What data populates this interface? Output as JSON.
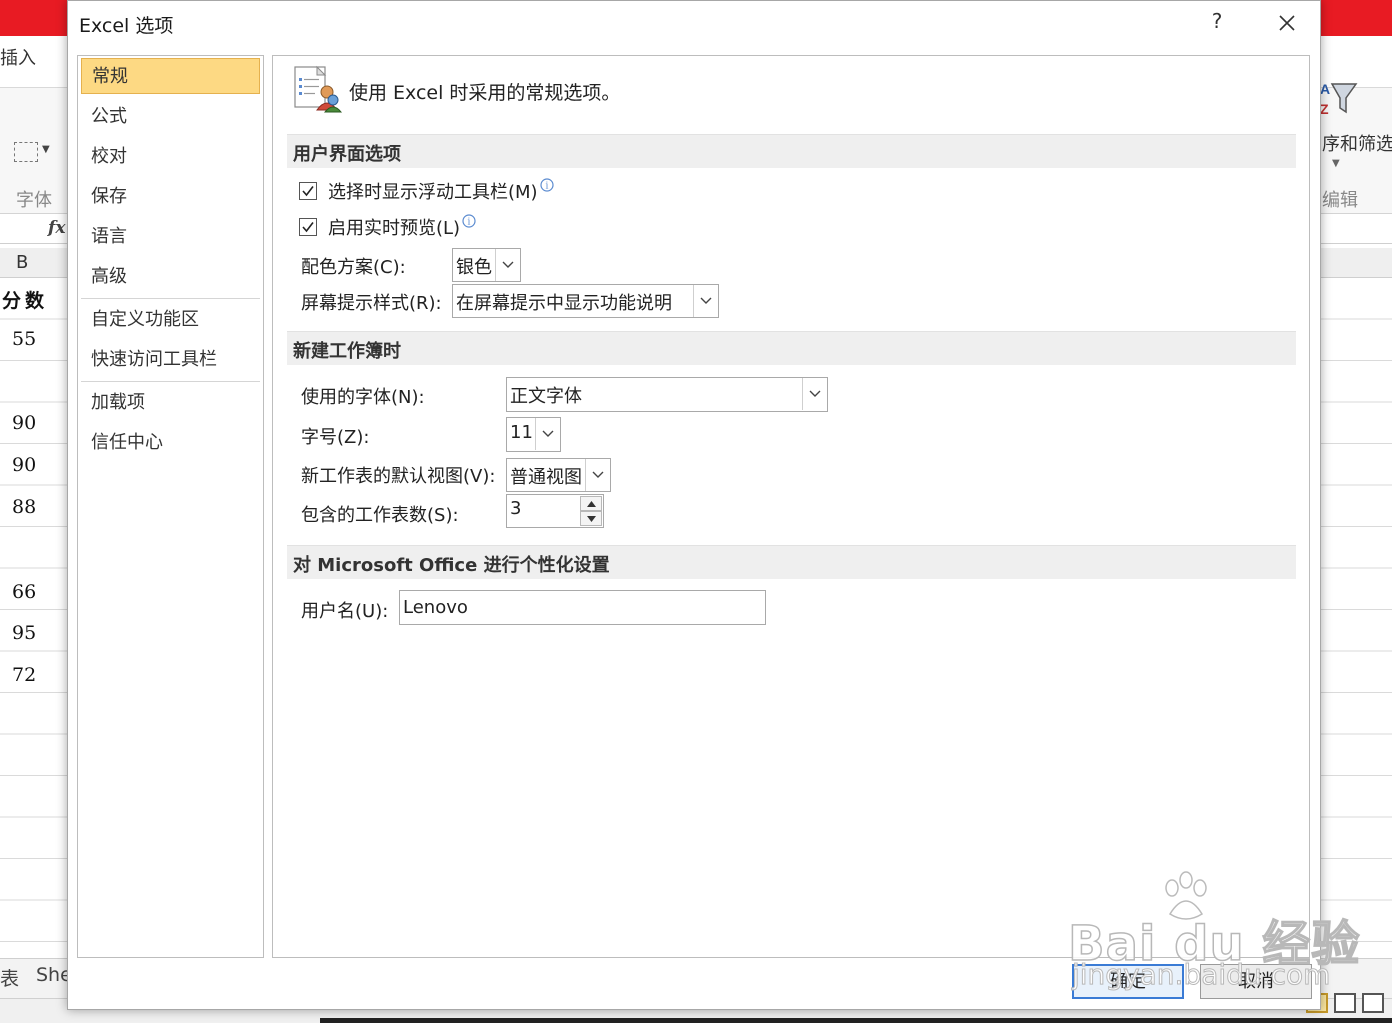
{
  "background": {
    "ribbon_tab_insert": "插入",
    "group_font": "字体",
    "formula_fx": "fx",
    "column_b": "B",
    "cells": [
      "分数",
      "55",
      "",
      "90",
      "90",
      "88",
      "",
      "66",
      "95",
      "72"
    ],
    "sort_filter_label": "序和筛选 查",
    "group_edit": "编辑",
    "sheet_tabs": [
      "表",
      "She"
    ]
  },
  "dialog": {
    "title": "Excel 选项",
    "help": "?",
    "nav": {
      "items": [
        {
          "label": "常规",
          "selected": true
        },
        {
          "label": "公式"
        },
        {
          "label": "校对"
        },
        {
          "label": "保存"
        },
        {
          "label": "语言"
        },
        {
          "label": "高级"
        },
        {
          "label": "自定义功能区"
        },
        {
          "label": "快速访问工具栏"
        },
        {
          "label": "加载项"
        },
        {
          "label": "信任中心"
        }
      ]
    },
    "header_text": "使用 Excel 时采用的常规选项。",
    "ui_section": {
      "title": "用户界面选项",
      "mini_toolbar": {
        "label": "选择时显示浮动工具栏(M)",
        "checked": true
      },
      "live_preview": {
        "label": "启用实时预览(L)",
        "checked": true
      },
      "color_scheme": {
        "label": "配色方案(C):",
        "value": "银色"
      },
      "screentip": {
        "label": "屏幕提示样式(R):",
        "value": "在屏幕提示中显示功能说明"
      }
    },
    "new_workbook_section": {
      "title": "新建工作簿时",
      "font": {
        "label": "使用的字体(N):",
        "value": "正文字体"
      },
      "font_size": {
        "label": "字号(Z):",
        "value": "11"
      },
      "default_view": {
        "label": "新工作表的默认视图(V):",
        "value": "普通视图"
      },
      "sheet_count": {
        "label": "包含的工作表数(S):",
        "value": "3"
      }
    },
    "personalize_section": {
      "title": "对 Microsoft Office 进行个性化设置",
      "username": {
        "label": "用户名(U):",
        "value": "Lenovo"
      }
    },
    "buttons": {
      "ok": "确定",
      "cancel": "取消"
    }
  },
  "watermark": {
    "text": "Bai du 经验",
    "url": "jingyan.baidu.com"
  },
  "colors": {
    "title_red": "#e81b23",
    "nav_selected": "#fdd983",
    "section_bg": "#efefef",
    "accent_blue": "#3a7bd5"
  }
}
